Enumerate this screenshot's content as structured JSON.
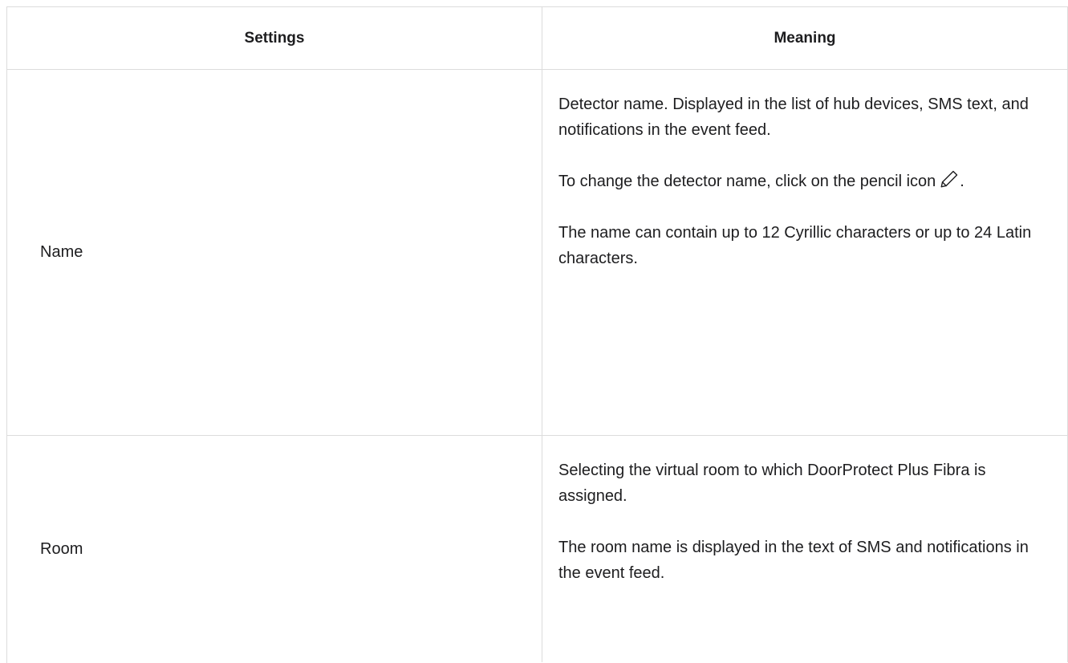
{
  "table": {
    "headers": {
      "settings": "Settings",
      "meaning": "Meaning"
    },
    "rows": [
      {
        "setting": "Name",
        "meaning": {
          "p1": "Detector name. Displayed in the list of hub devices, SMS text, and notifications in the event feed.",
          "p2_prefix": "To change the detector name, click on the pencil icon",
          "p2_icon": "pencil-icon",
          "p2_suffix": ".",
          "p3": "The name can contain up to 12 Cyrillic characters or up to 24 Latin characters."
        }
      },
      {
        "setting": "Room",
        "meaning": {
          "p1": "Selecting the virtual room to which DoorProtect Plus Fibra is assigned.",
          "p2": "The room name is displayed in the text of SMS and notifications in the event feed."
        }
      }
    ]
  },
  "colors": {
    "border": "#dcdcdc",
    "text": "#1d1d1f"
  }
}
